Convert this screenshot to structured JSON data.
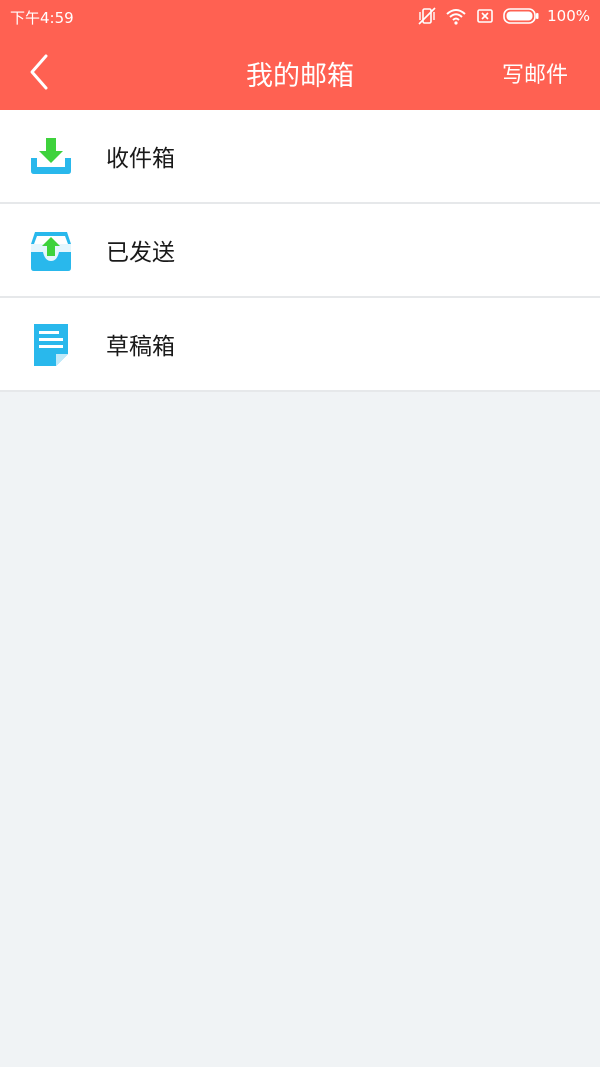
{
  "status_bar": {
    "time": "下午4:59",
    "battery": "100%",
    "icons": [
      "vibrate-off-icon",
      "wifi-icon",
      "no-sim-icon",
      "battery-icon"
    ]
  },
  "header": {
    "title": "我的邮箱",
    "compose_label": "写邮件",
    "back_icon": "chevron-left-icon"
  },
  "menu": {
    "items": [
      {
        "label": "收件箱",
        "icon": "inbox-download-icon"
      },
      {
        "label": "已发送",
        "icon": "sent-upload-icon"
      },
      {
        "label": "草稿箱",
        "icon": "draft-document-icon"
      }
    ]
  },
  "colors": {
    "header_bg": "#ff6152",
    "page_bg": "#f0f3f5",
    "icon_blue": "#29b8ec",
    "icon_green": "#3ed23c"
  }
}
